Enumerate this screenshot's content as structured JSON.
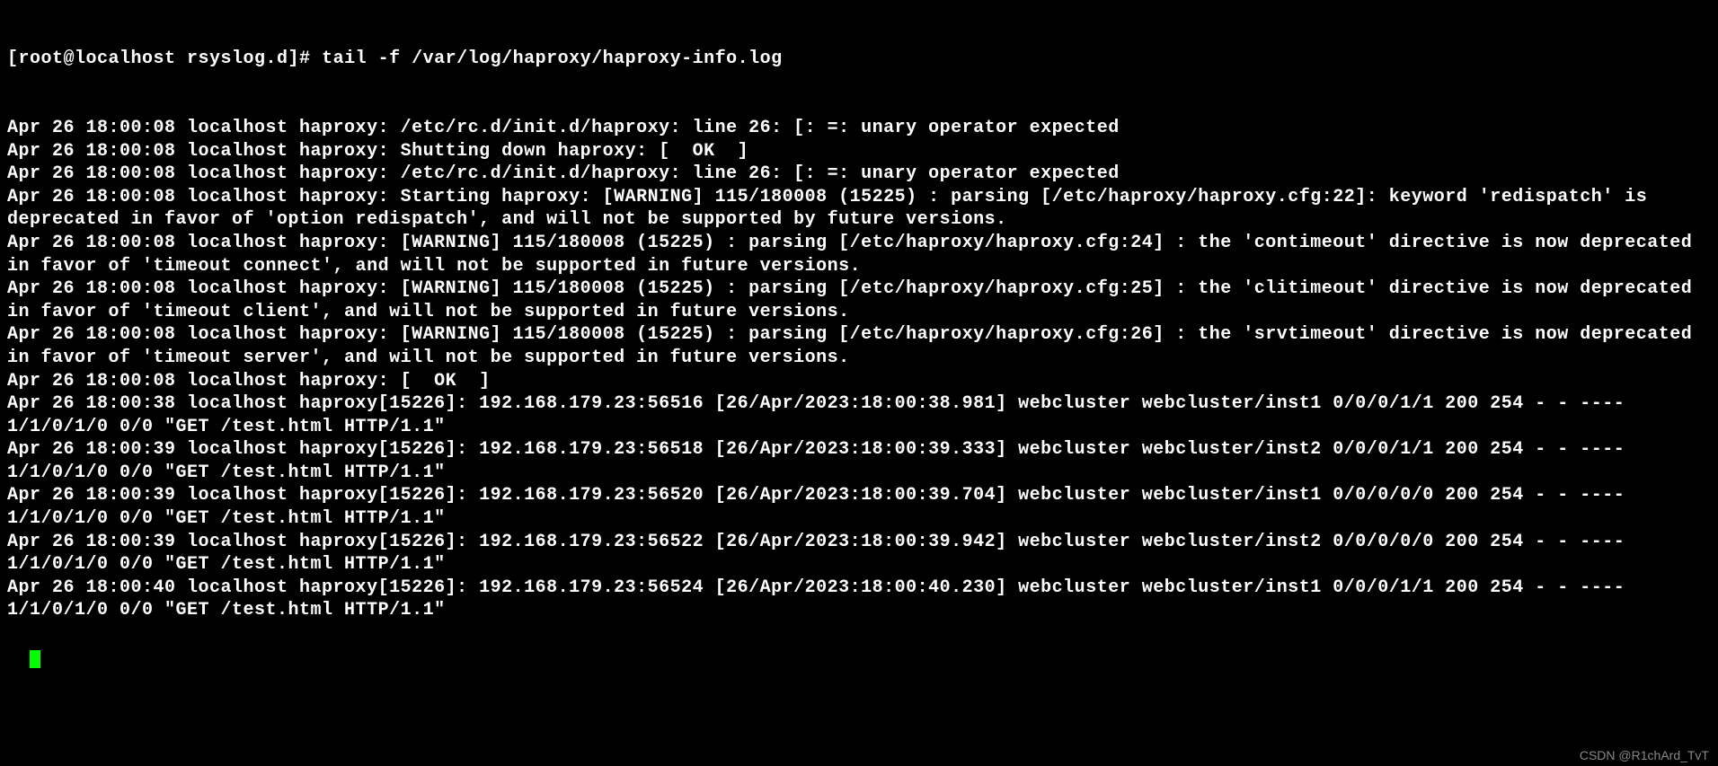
{
  "prompt": "[root@localhost rsyslog.d]# ",
  "command": "tail -f /var/log/haproxy/haproxy-info.log",
  "lines": [
    "Apr 26 18:00:08 localhost haproxy: /etc/rc.d/init.d/haproxy: line 26: [: =: unary operator expected",
    "Apr 26 18:00:08 localhost haproxy: Shutting down haproxy: [  OK  ]",
    "Apr 26 18:00:08 localhost haproxy: /etc/rc.d/init.d/haproxy: line 26: [: =: unary operator expected",
    "Apr 26 18:00:08 localhost haproxy: Starting haproxy: [WARNING] 115/180008 (15225) : parsing [/etc/haproxy/haproxy.cfg:22]: keyword 'redispatch' is deprecated in favor of 'option redispatch', and will not be supported by future versions.",
    "Apr 26 18:00:08 localhost haproxy: [WARNING] 115/180008 (15225) : parsing [/etc/haproxy/haproxy.cfg:24] : the 'contimeout' directive is now deprecated in favor of 'timeout connect', and will not be supported in future versions.",
    "Apr 26 18:00:08 localhost haproxy: [WARNING] 115/180008 (15225) : parsing [/etc/haproxy/haproxy.cfg:25] : the 'clitimeout' directive is now deprecated in favor of 'timeout client', and will not be supported in future versions.",
    "Apr 26 18:00:08 localhost haproxy: [WARNING] 115/180008 (15225) : parsing [/etc/haproxy/haproxy.cfg:26] : the 'srvtimeout' directive is now deprecated in favor of 'timeout server', and will not be supported in future versions.",
    "Apr 26 18:00:08 localhost haproxy: [  OK  ]",
    "Apr 26 18:00:38 localhost haproxy[15226]: 192.168.179.23:56516 [26/Apr/2023:18:00:38.981] webcluster webcluster/inst1 0/0/0/1/1 200 254 - - ---- 1/1/0/1/0 0/0 \"GET /test.html HTTP/1.1\"",
    "Apr 26 18:00:39 localhost haproxy[15226]: 192.168.179.23:56518 [26/Apr/2023:18:00:39.333] webcluster webcluster/inst2 0/0/0/1/1 200 254 - - ---- 1/1/0/1/0 0/0 \"GET /test.html HTTP/1.1\"",
    "Apr 26 18:00:39 localhost haproxy[15226]: 192.168.179.23:56520 [26/Apr/2023:18:00:39.704] webcluster webcluster/inst1 0/0/0/0/0 200 254 - - ---- 1/1/0/1/0 0/0 \"GET /test.html HTTP/1.1\"",
    "Apr 26 18:00:39 localhost haproxy[15226]: 192.168.179.23:56522 [26/Apr/2023:18:00:39.942] webcluster webcluster/inst2 0/0/0/0/0 200 254 - - ---- 1/1/0/1/0 0/0 \"GET /test.html HTTP/1.1\"",
    "Apr 26 18:00:40 localhost haproxy[15226]: 192.168.179.23:56524 [26/Apr/2023:18:00:40.230] webcluster webcluster/inst1 0/0/0/1/1 200 254 - - ---- 1/1/0/1/0 0/0 \"GET /test.html HTTP/1.1\""
  ],
  "watermark": "CSDN @R1chArd_TvT"
}
